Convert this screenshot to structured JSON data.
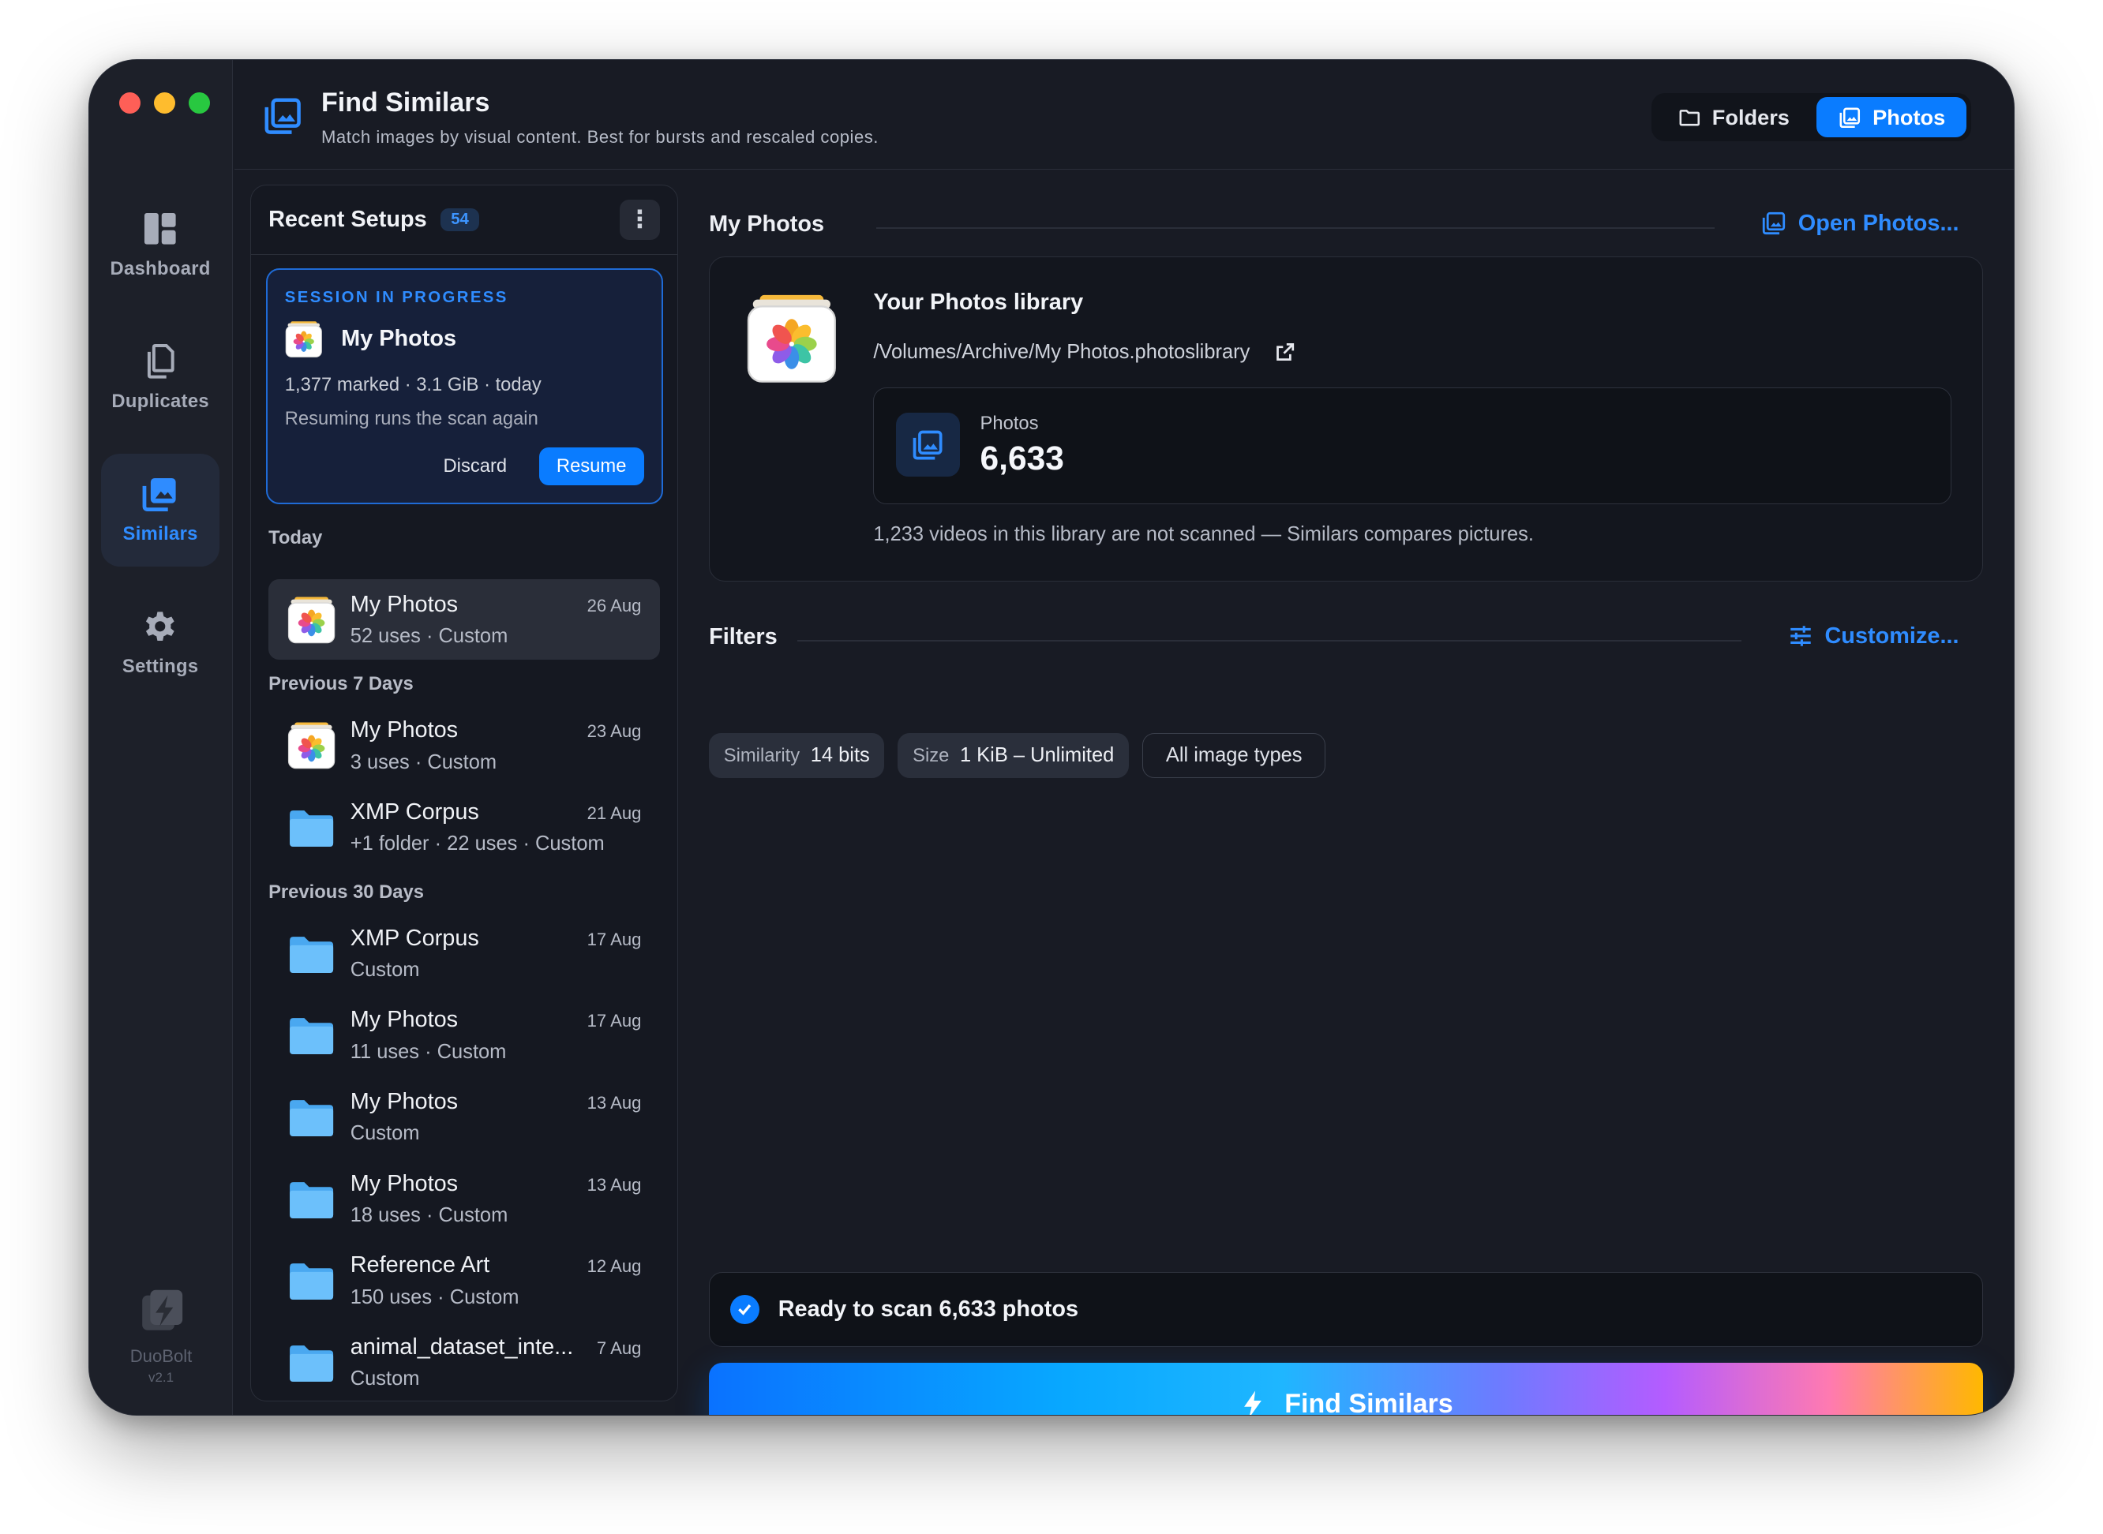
{
  "sidebar": {
    "items": [
      {
        "label": "Dashboard",
        "icon": "dashboard-icon"
      },
      {
        "label": "Duplicates",
        "icon": "duplicates-icon"
      },
      {
        "label": "Similars",
        "icon": "similars-icon",
        "active": true
      },
      {
        "label": "Settings",
        "icon": "gear-icon"
      }
    ],
    "brand": {
      "name": "DuoBolt",
      "version": "v2.1"
    }
  },
  "header": {
    "title": "Find Similars",
    "subtitle": "Match images by visual content. Best for bursts and rescaled copies.",
    "segments": [
      {
        "label": "Folders",
        "icon": "folder-icon",
        "selected": false
      },
      {
        "label": "Photos",
        "icon": "photos-icon",
        "selected": true
      }
    ]
  },
  "recent": {
    "title": "Recent Setups",
    "count": "54",
    "session": {
      "label": "SESSION IN PROGRESS",
      "name": "My Photos",
      "meta": "1,377 marked · 3.1 GiB · today",
      "hint": "Resuming runs the scan again",
      "discard": "Discard",
      "resume": "Resume"
    },
    "groups": [
      {
        "label": "Today"
      },
      {
        "label": "Previous 7 Days"
      },
      {
        "label": "Previous 30 Days"
      }
    ],
    "items": [
      {
        "name": "My Photos",
        "sub": "52 uses · Custom",
        "date": "26 Aug",
        "icon": "photos-app-icon"
      },
      {
        "name": "My Photos",
        "sub": "3 uses · Custom",
        "date": "23 Aug",
        "icon": "photos-app-icon"
      },
      {
        "name": "XMP Corpus",
        "sub": "+1 folder · 22 uses · Custom",
        "date": "21 Aug",
        "icon": "folder-icon"
      },
      {
        "name": "XMP Corpus",
        "sub": "Custom",
        "date": "17 Aug",
        "icon": "folder-icon"
      },
      {
        "name": "My Photos",
        "sub": "11 uses · Custom",
        "date": "17 Aug",
        "icon": "folder-icon"
      },
      {
        "name": "My Photos",
        "sub": "Custom",
        "date": "13 Aug",
        "icon": "folder-icon"
      },
      {
        "name": "My Photos",
        "sub": "18 uses · Custom",
        "date": "13 Aug",
        "icon": "folder-icon"
      },
      {
        "name": "Reference Art",
        "sub": "150 uses · Custom",
        "date": "12 Aug",
        "icon": "folder-icon"
      },
      {
        "name": "animal_dataset_inte...",
        "sub": "Custom",
        "date": "7 Aug",
        "icon": "folder-icon"
      }
    ]
  },
  "main": {
    "source_title": "My Photos",
    "open_action": "Open Photos...",
    "library": {
      "title": "Your Photos library",
      "path": "/Volumes/Archive/My Photos.photoslibrary",
      "stat_label": "Photos",
      "stat_value": "6,633",
      "note": "1,233 videos in this library are not scanned — Similars compares pictures."
    },
    "filters": {
      "title": "Filters",
      "action": "Customize...",
      "similarity_key": "Similarity",
      "similarity_val": "14 bits",
      "size_key": "Size",
      "size_val": "1 KiB – Unlimited",
      "types": "All image types"
    },
    "ready": "Ready to scan 6,633 photos",
    "cta": "Find Similars"
  },
  "colors": {
    "accent": "#0a7cff",
    "background": "#181b24",
    "panel": "#151821"
  }
}
